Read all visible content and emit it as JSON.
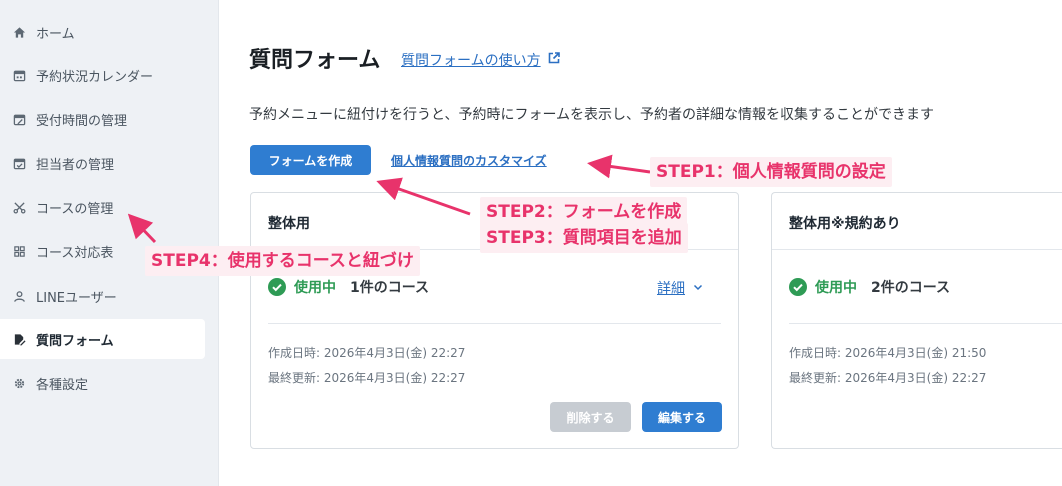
{
  "sidebar": {
    "items": [
      {
        "label": "ホーム",
        "icon": "home-icon"
      },
      {
        "label": "予約状況カレンダー",
        "icon": "calendar-icon"
      },
      {
        "label": "受付時間の管理",
        "icon": "calendar-edit-icon"
      },
      {
        "label": "担当者の管理",
        "icon": "calendar-check-icon"
      },
      {
        "label": "コースの管理",
        "icon": "scissors-icon"
      },
      {
        "label": "コース対応表",
        "icon": "grid-icon"
      },
      {
        "label": "LINEユーザー",
        "icon": "user-icon"
      },
      {
        "label": "質問フォーム",
        "icon": "form-edit-icon",
        "active": true
      },
      {
        "label": "各種設定",
        "icon": "gear-icon"
      }
    ]
  },
  "main": {
    "title": "質問フォーム",
    "help_link": "質問フォームの使い方",
    "description": "予約メニューに紐付けを行うと、予約時にフォームを表示し、予約者の詳細な情報を収集することができます",
    "create_button": "フォームを作成",
    "customize_link": "個人情報質問のカスタマイズ"
  },
  "cards": [
    {
      "title": "整体用",
      "status": "使用中",
      "course_count": "1件のコース",
      "detail_link": "詳細",
      "created": "作成日時: 2026年4月3日(金) 22:27",
      "updated": "最終更新: 2026年4月3日(金) 22:27",
      "delete_button": "削除する",
      "edit_button": "編集する"
    },
    {
      "title": "整体用※規約あり",
      "status": "使用中",
      "course_count": "2件のコース",
      "created": "作成日時: 2026年4月3日(金) 21:50",
      "updated": "最終更新: 2026年4月3日(金) 22:27"
    }
  ],
  "annotations": {
    "step1": "STEP1：個人情報質問の設定",
    "step2": "STEP2：フォームを作成",
    "step3": "STEP3：質問項目を追加",
    "step4": "STEP4：使用するコースと紐づけ",
    "color": "#e8336b"
  },
  "colors": {
    "accent": "#2f7dd1",
    "success": "#2e9b55",
    "disabled": "#c7ccd2"
  }
}
